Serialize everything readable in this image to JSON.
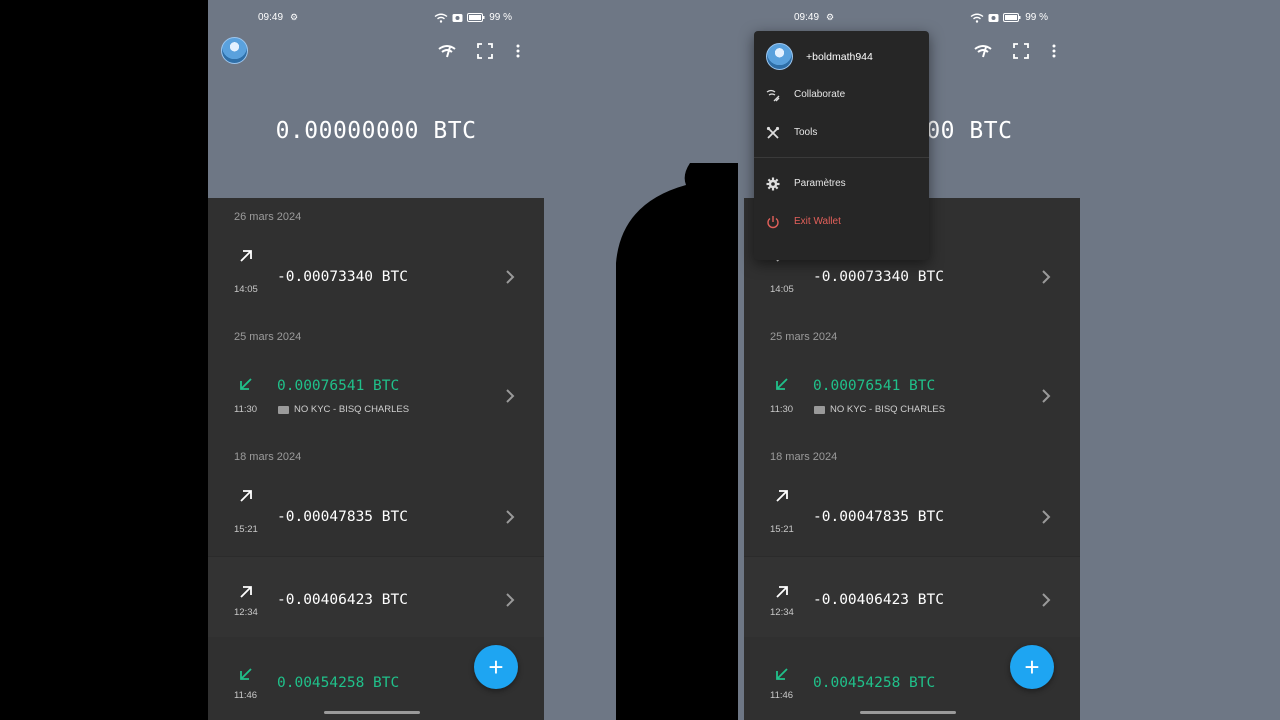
{
  "status": {
    "time": "09:49",
    "battery": "99 %"
  },
  "balance": "0.00000000 BTC",
  "transactions": [
    {
      "date": "26 mars 2024",
      "time": "14:05",
      "amount": "-0.00073340 BTC",
      "direction": "out",
      "label": ""
    },
    {
      "date": "25 mars 2024",
      "time": "11:30",
      "amount": "0.00076541 BTC",
      "direction": "in",
      "label": "NO KYC - BISQ CHARLES"
    },
    {
      "date": "18 mars 2024",
      "time": "15:21",
      "amount": "-0.00047835 BTC",
      "direction": "out",
      "label": ""
    },
    {
      "date": "",
      "time": "12:34",
      "amount": "-0.00406423 BTC",
      "direction": "out",
      "label": ""
    },
    {
      "date": "",
      "time": "11:46",
      "amount": "0.00454258 BTC",
      "direction": "in",
      "label": ""
    }
  ],
  "menu": {
    "username": "+boldmath944",
    "items": [
      "Collaborate",
      "Tools",
      "Paramètres",
      "Exit Wallet"
    ]
  },
  "fab_label": "+",
  "colors": {
    "accent": "#1ea5f2",
    "incoming": "#20c08a",
    "danger": "#e2605a",
    "background": "#6e7785",
    "list": "#303030"
  }
}
